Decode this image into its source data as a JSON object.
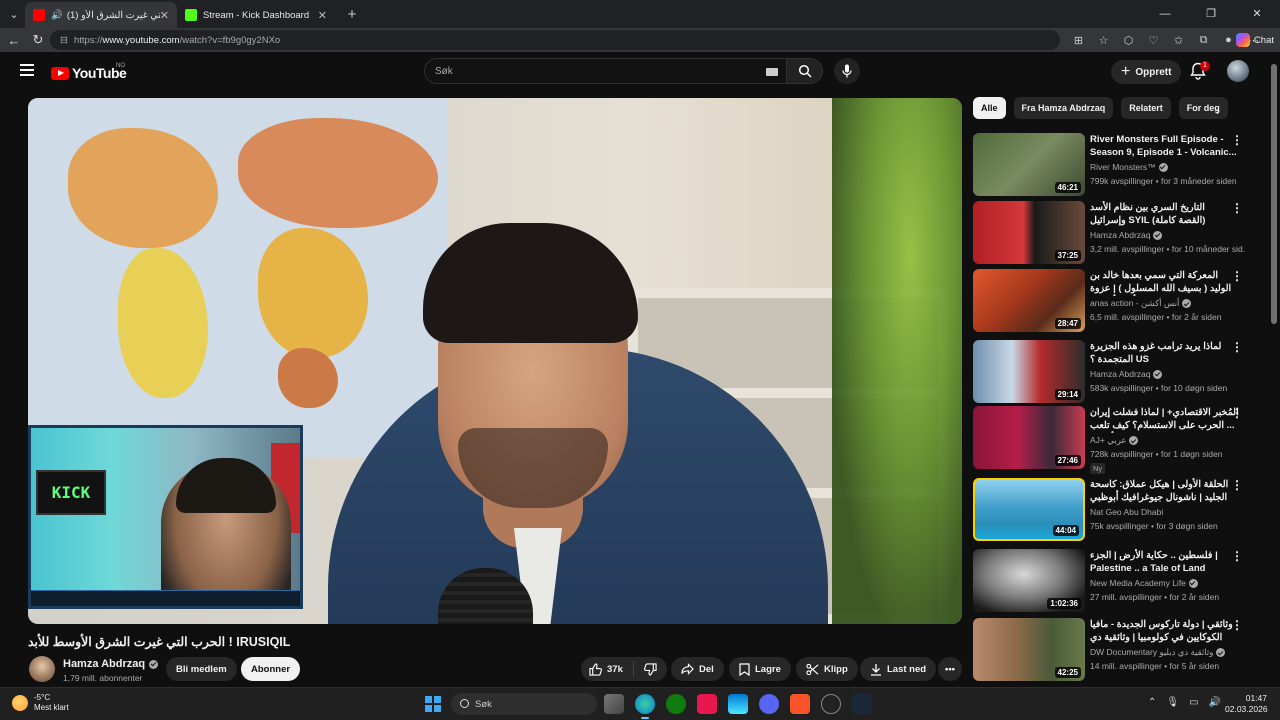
{
  "browser": {
    "tabs": [
      {
        "title": "(1) الحرب التي غيرت الشرق الأو",
        "active": true
      },
      {
        "title": "Stream - Kick Dashboard",
        "active": false
      }
    ],
    "url_prefix": "https://",
    "url_host": "www.youtube.com",
    "url_path": "/watch?v=fb9g0gy2NXo",
    "chat_label": "Chat"
  },
  "header": {
    "logo_text": "YouTube",
    "country_code": "NO",
    "search_placeholder": "Søk",
    "create_label": "Opprett",
    "notification_count": "1"
  },
  "video": {
    "title": "الحرب التي غيرت الشرق الأوسط للأبد ! IRUSIQIL",
    "overlay_monitor_text": "KICK"
  },
  "channel": {
    "name": "Hamza Abdrzaq",
    "subscribers": "1,79 mill. abonnenter",
    "join_label": "Bli medlem",
    "subscribe_label": "Abonner"
  },
  "actions": {
    "likes": "37k",
    "share": "Del",
    "save": "Lagre",
    "clip": "Klipp",
    "download": "Last ned"
  },
  "chips": [
    "Alle",
    "Fra Hamza Abdrzaq",
    "Relatert",
    "For deg"
  ],
  "related": [
    {
      "title": "River Monsters Full Episode - Season 9, Episode 1 - Volcanic...",
      "channel": "River Monsters™",
      "meta": "799k avspillinger • for 3 måneder siden",
      "duration": "46:21",
      "badge": ""
    },
    {
      "title": "التاريخ السري بين نظام الأسد وإسرائيل SYIL (القصة كاملة)",
      "channel": "Hamza Abdrzaq",
      "meta": "3,2 mill. avspillinger • for 10 måneder sid...",
      "duration": "37:25",
      "badge": ""
    },
    {
      "title": "المعركة التي سمي بعدها خالد بن الوليد ( بسيف الله المسلول ) | عزوة مؤتة | أنس أكتشن",
      "channel": "anas action - أنس أكشن",
      "meta": "6,5 mill. avspillinger • for 2 år siden",
      "duration": "28:47",
      "badge": ""
    },
    {
      "title": "لماذا يريد ترامب غزو هذه الجزيرة المتجمدة ؟ US",
      "channel": "Hamza Abdrzaq",
      "meta": "583k avspillinger • for 10 døgn siden",
      "duration": "29:14",
      "badge": ""
    },
    {
      "title": "المُخبر الاقتصادي+ | لماذا فشلت إيران ... الحرب على الاستسلام؟ كيف تلعب أمريكا",
      "channel": "AJ+ عربي",
      "meta": "728k avspillinger • for 1 døgn siden",
      "duration": "27:46",
      "badge": "Ny"
    },
    {
      "title": "الحلقة الأولى | هيكل عملاق: كاسحة الجليد | ناشونال جيوغرافيك أبوظبي",
      "channel": "Nat Geo Abu Dhabi",
      "meta": "75k avspillinger • for 3 døgn siden",
      "duration": "44:04",
      "badge": ""
    },
    {
      "title": "فلسطين .. حكاية الأرض | الجزء | Palestine .. a Tale of Land",
      "channel": "New Media Academy Life",
      "meta": "27 mill. avspillinger • for 2 år siden",
      "duration": "1:02:36",
      "badge": ""
    },
    {
      "title": "وثائقي | دولة تاركوس الجديدة - مافيا الكوكايين في كولومبيا | وثائقية دي دبليو",
      "channel": "DW Documentary وثائقية دي دبليو",
      "meta": "14 mill. avspillinger • for 5 år siden",
      "duration": "42:25",
      "badge": ""
    }
  ],
  "taskbar": {
    "temperature": "-5°C",
    "weather": "Mest klart",
    "search_label": "Søk",
    "time": "01:47",
    "date": "02.03.2026"
  }
}
